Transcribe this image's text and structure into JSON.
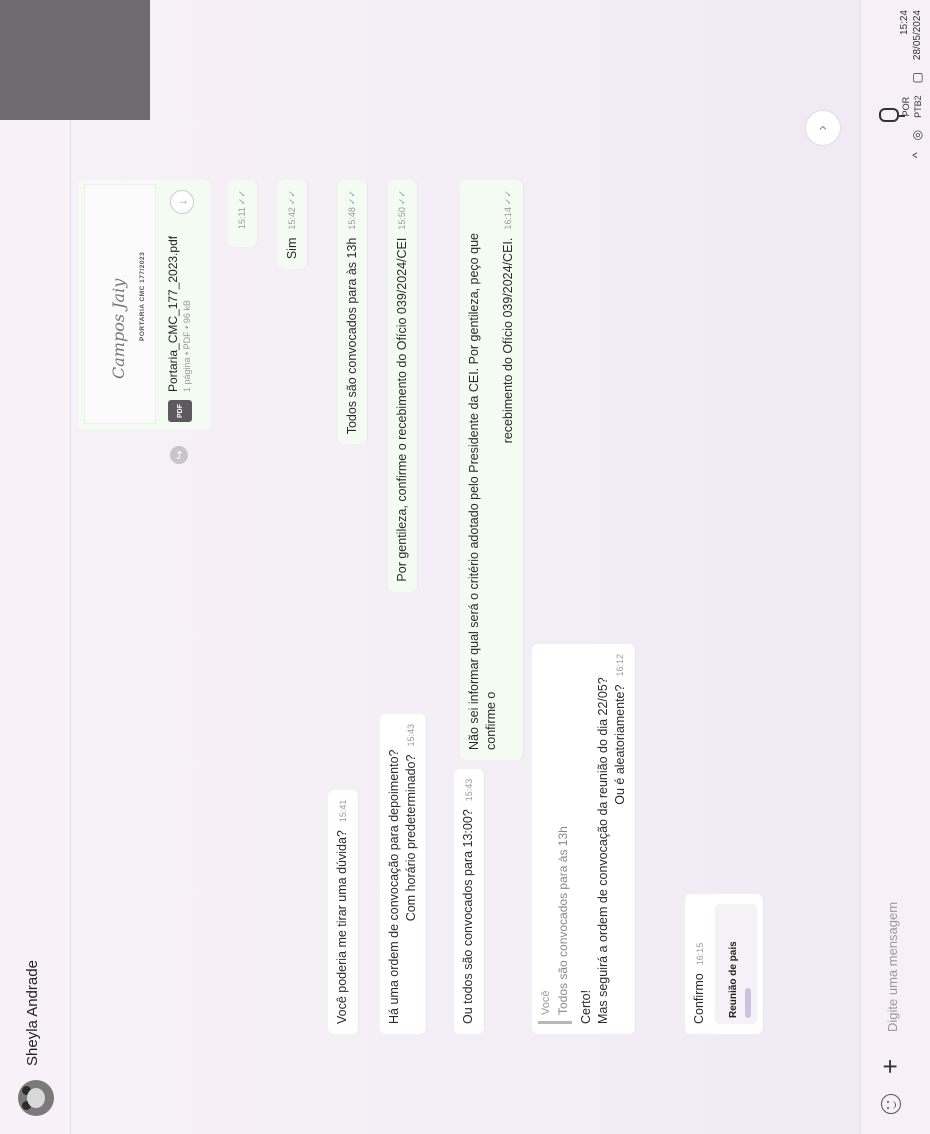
{
  "header": {
    "contact_name": "Sheyla Andrade"
  },
  "file": {
    "signature": "Campos Jaiy",
    "preview_title": "PORTARIA CMC 177/2023",
    "badge": "PDF",
    "name": "Portaria_CMC_177_2023.pdf",
    "meta": "1 página • PDF • 96 kB",
    "time": "15:11"
  },
  "messages": {
    "incoming": [
      {
        "lines": [
          "Você poderia me tirar uma dúvida?"
        ],
        "time": "15:41"
      },
      {
        "lines": [
          "Há uma ordem de convocação para depoimento?",
          "Com horário predeterminado?"
        ],
        "time": "15:43"
      },
      {
        "lines": [
          "Ou todos são convocados para 13:00?"
        ],
        "time": "15:43"
      }
    ],
    "reply": {
      "quote_who": "Você",
      "quote_text": "Todos são convocados para às 13h",
      "lines": [
        "Certo!",
        "Mas seguirá a ordem de convocação da reunião do dia 22/05?",
        "Ou é aleatoriamente?"
      ],
      "time": "16:12"
    },
    "confirm": {
      "text": "Confirmo",
      "time": "16:15",
      "group_title": "Reunião de pais"
    },
    "outgoing": [
      {
        "lines": [
          "Sim"
        ],
        "time": "15:42"
      },
      {
        "lines": [
          "Todos são convocados para às 13h"
        ],
        "time": "15:48"
      },
      {
        "lines": [
          "Por gentileza, confirme o recebimento do Ofício 039/2024/CEI"
        ],
        "time": "15:50"
      },
      {
        "lines": [
          "Não sei informar qual será o critério adotado pelo Presidente da CEI. Por gentileza, peço que confirme o",
          "recebimento do Ofício 039/2024/CEI."
        ],
        "time": "16:14"
      }
    ],
    "ticks": "✓✓"
  },
  "input": {
    "placeholder": "Digite uma mensagem"
  },
  "tray": {
    "lang": "POR",
    "layout": "PTB2",
    "time": "15:24",
    "date": "28/05/2024"
  },
  "icons": {
    "search": "search-icon",
    "menu": "more-vert-icon",
    "download": "download-icon",
    "forward": "forward-icon",
    "emoji": "emoji-icon",
    "plus": "plus-icon",
    "mic": "microphone-icon",
    "scroll": "chevron-right-icon"
  }
}
